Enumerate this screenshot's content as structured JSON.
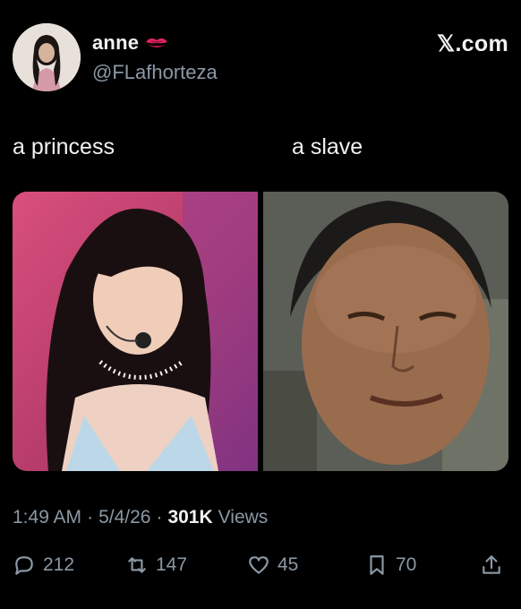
{
  "author": {
    "name": "anne",
    "handle": "@FLafhorteza",
    "name_emoji_icon": "kiss-mark-icon",
    "avatar_icon": "profile-photo"
  },
  "brand": "𝕏.com",
  "captions": {
    "left": "a princess",
    "right": "a slave"
  },
  "media": [
    {
      "description_icon": "photo-performer-with-headset-mic"
    },
    {
      "description_icon": "photo-woman-closeup"
    }
  ],
  "meta": {
    "time": "1:49 AM",
    "date": "5/4/26",
    "separator": "·",
    "views_count": "301K",
    "views_label": "Views"
  },
  "actions": {
    "replies": "212",
    "reposts": "147",
    "likes": "45",
    "bookmarks": "70"
  },
  "colors": {
    "background": "#000000",
    "text": "#f2f2f2",
    "muted": "#8b98a5",
    "emoji_red": "#e0245e"
  }
}
